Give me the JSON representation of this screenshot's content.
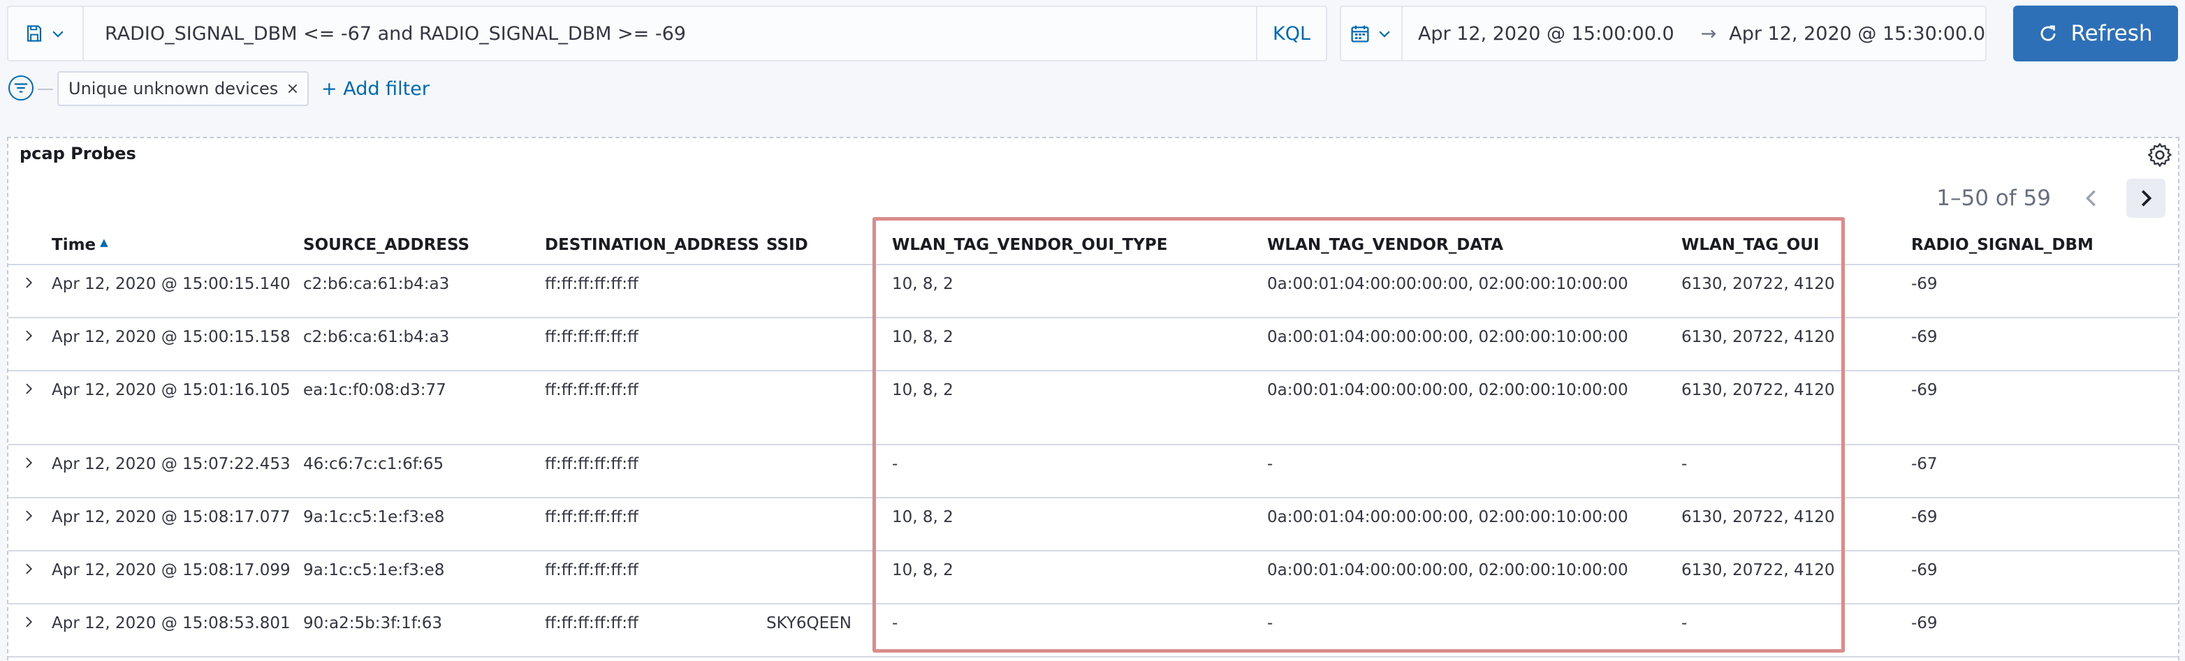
{
  "query_bar": {
    "query": "RADIO_SIGNAL_DBM <= -67 and RADIO_SIGNAL_DBM >= -69",
    "language": "KQL"
  },
  "date_picker": {
    "start": "Apr 12, 2020 @ 15:00:00.0",
    "end": "Apr 12, 2020 @ 15:30:00.0",
    "arrow": "→"
  },
  "refresh_label": "Refresh",
  "filters": {
    "pills": [
      {
        "label": "Unique unknown devices"
      }
    ],
    "add_label": "+ Add filter"
  },
  "panel": {
    "title": "pcap Probes",
    "pagination": "1–50 of 59"
  },
  "table": {
    "columns": [
      "Time",
      "SOURCE_ADDRESS",
      "DESTINATION_ADDRESS",
      "SSID",
      "WLAN_TAG_VENDOR_OUI_TYPE",
      "WLAN_TAG_VENDOR_DATA",
      "WLAN_TAG_OUI",
      "RADIO_SIGNAL_DBM"
    ],
    "sort": {
      "column": "Time",
      "direction": "ascending"
    },
    "rows": [
      [
        "Apr 12, 2020 @ 15:00:15.140",
        "c2:b6:ca:61:b4:a3",
        "ff:ff:ff:ff:ff:ff",
        "",
        "10, 8, 2",
        "0a:00:01:04:00:00:00:00, 02:00:00:10:00:00",
        "6130, 20722, 4120",
        "-69"
      ],
      [
        "Apr 12, 2020 @ 15:00:15.158",
        "c2:b6:ca:61:b4:a3",
        "ff:ff:ff:ff:ff:ff",
        "",
        "10, 8, 2",
        "0a:00:01:04:00:00:00:00, 02:00:00:10:00:00",
        "6130, 20722, 4120",
        "-69"
      ],
      [
        "Apr 12, 2020 @ 15:01:16.105",
        "ea:1c:f0:08:d3:77",
        "ff:ff:ff:ff:ff:ff",
        "",
        "10, 8, 2",
        "0a:00:01:04:00:00:00:00, 02:00:00:10:00:00",
        "6130, 20722, 4120",
        "-69"
      ],
      [
        "Apr 12, 2020 @ 15:07:22.453",
        "46:c6:7c:c1:6f:65",
        "ff:ff:ff:ff:ff:ff",
        "",
        "-",
        "-",
        "-",
        "-67"
      ],
      [
        "Apr 12, 2020 @ 15:08:17.077",
        "9a:1c:c5:1e:f3:e8",
        "ff:ff:ff:ff:ff:ff",
        "",
        "10, 8, 2",
        "0a:00:01:04:00:00:00:00, 02:00:00:10:00:00",
        "6130, 20722, 4120",
        "-69"
      ],
      [
        "Apr 12, 2020 @ 15:08:17.099",
        "9a:1c:c5:1e:f3:e8",
        "ff:ff:ff:ff:ff:ff",
        "",
        "10, 8, 2",
        "0a:00:01:04:00:00:00:00, 02:00:00:10:00:00",
        "6130, 20722, 4120",
        "-69"
      ],
      [
        "Apr 12, 2020 @ 15:08:53.801",
        "90:a2:5b:3f:1f:63",
        "ff:ff:ff:ff:ff:ff",
        "SKY6QEEN",
        "-",
        "-",
        "-",
        "-69"
      ]
    ]
  },
  "colors": {
    "accent": "#006bb4",
    "refresh_button": "#2d70b8",
    "highlight_box": "#d98c8a"
  },
  "icons": {
    "saved_query": "save-icon",
    "calendar": "calendar-icon",
    "refresh": "refresh-icon",
    "filter_options": "filter-icon",
    "remove_filter": "close-icon",
    "panel_settings": "gear-icon",
    "expand_row": "chevron-right-icon"
  }
}
